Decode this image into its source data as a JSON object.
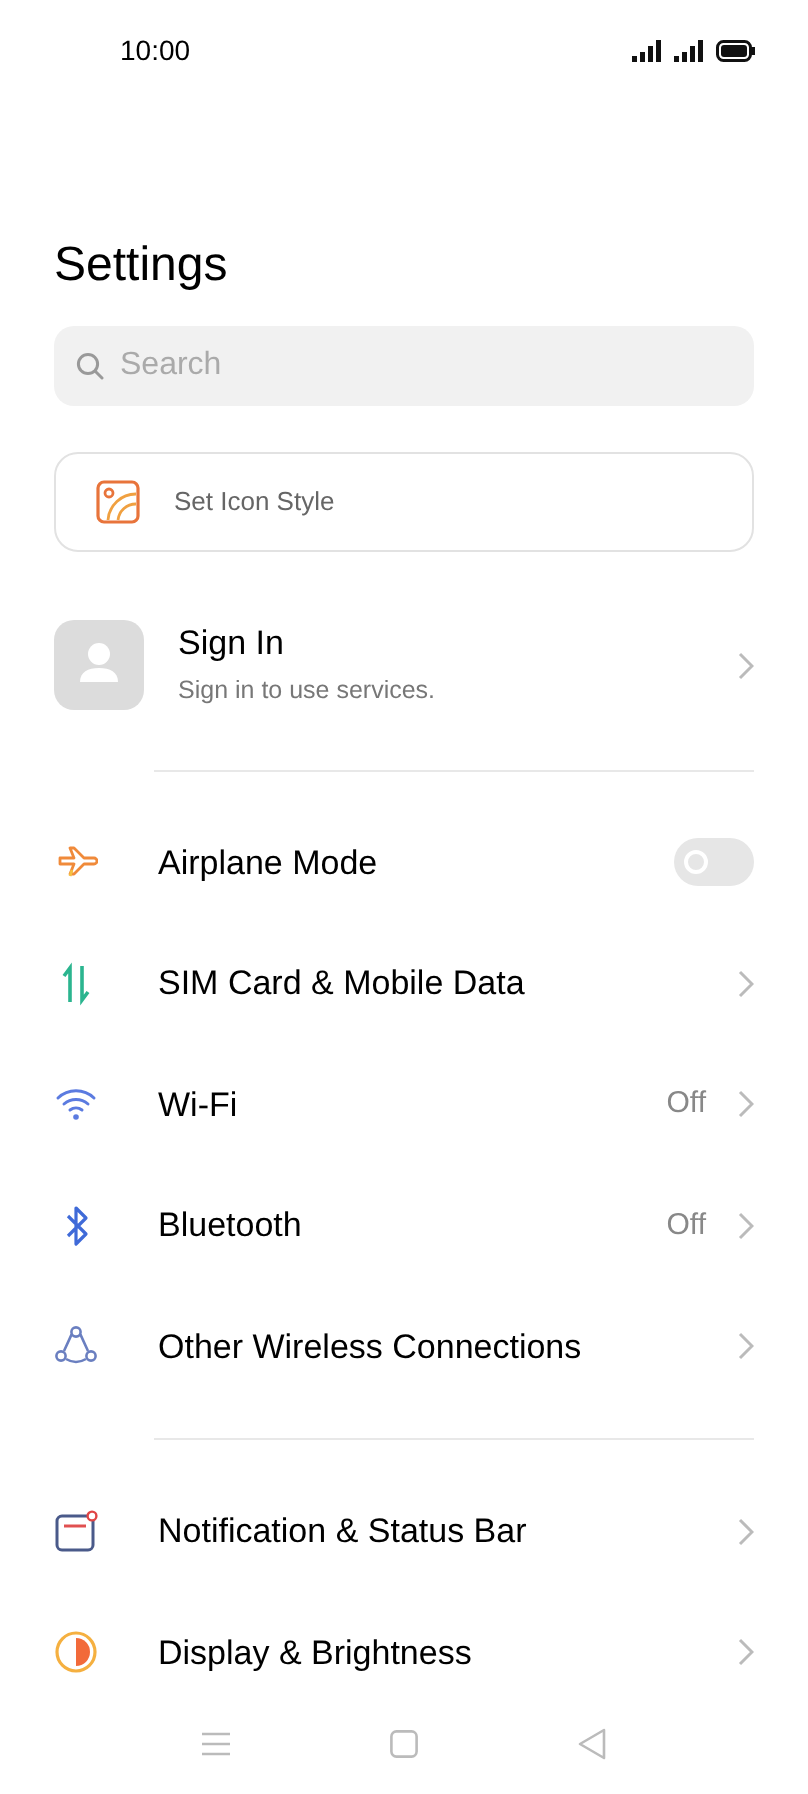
{
  "status_bar": {
    "time": "10:00"
  },
  "title": "Settings",
  "search": {
    "placeholder": "Search"
  },
  "icon_style": {
    "label": "Set Icon Style"
  },
  "account": {
    "title": "Sign In",
    "subtitle": "Sign in to use services."
  },
  "groups": [
    {
      "items": [
        {
          "kind": "toggle",
          "label": "Airplane Mode",
          "on": false
        },
        {
          "kind": "link",
          "label": "SIM Card & Mobile Data"
        },
        {
          "kind": "link",
          "label": "Wi-Fi",
          "value": "Off"
        },
        {
          "kind": "link",
          "label": "Bluetooth",
          "value": "Off"
        },
        {
          "kind": "link",
          "label": "Other Wireless Connections"
        }
      ]
    },
    {
      "items": [
        {
          "kind": "link",
          "label": "Notification & Status Bar"
        },
        {
          "kind": "link",
          "label": "Display & Brightness"
        }
      ]
    }
  ]
}
